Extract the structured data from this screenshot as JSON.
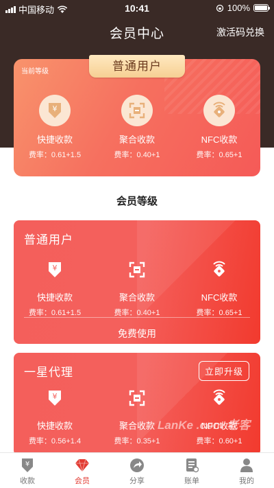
{
  "status_bar": {
    "carrier": "中国移动",
    "time": "10:41",
    "battery": "100%"
  },
  "header": {
    "title": "会员中心",
    "action": "激活码兑换"
  },
  "current": {
    "label": "当前等级",
    "level": "普通用户",
    "features": [
      {
        "name": "快捷收款",
        "rate": "费率：0.61+1.5",
        "icon": "yen-envelope-icon"
      },
      {
        "name": "聚合收款",
        "rate": "费率：0.40+1",
        "icon": "scan-icon"
      },
      {
        "name": "NFC收款",
        "rate": "费率：0.65+1",
        "icon": "nfc-tag-icon"
      }
    ]
  },
  "section_title": "会员等级",
  "levels": [
    {
      "title": "普通用户",
      "features": [
        {
          "name": "快捷收款",
          "rate": "费率：0.61+1.5"
        },
        {
          "name": "聚合收款",
          "rate": "费率：0.40+1"
        },
        {
          "name": "NFC收款",
          "rate": "费率：0.65+1"
        }
      ],
      "footer": "免费使用"
    },
    {
      "title": "一星代理",
      "action": "立即升级",
      "features": [
        {
          "name": "快捷收款",
          "rate": "费率：0.56+1.4"
        },
        {
          "name": "聚合收款",
          "rate": "费率：0.35+1"
        },
        {
          "name": "NFC收款",
          "rate": "费率：0.60+1"
        }
      ]
    }
  ],
  "watermark": "LanKe .com 老客",
  "tabbar": [
    {
      "label": "收款",
      "icon": "receive-icon",
      "active": false
    },
    {
      "label": "会员",
      "icon": "member-diamond-icon",
      "active": true
    },
    {
      "label": "分享",
      "icon": "share-icon",
      "active": false
    },
    {
      "label": "账单",
      "icon": "bill-icon",
      "active": false
    },
    {
      "label": "我的",
      "icon": "profile-icon",
      "active": false
    }
  ],
  "colors": {
    "accent": "#e23b32",
    "header_bg": "#3a2a26",
    "card_red": "#f45f5b",
    "gold": "#f6cf93"
  }
}
